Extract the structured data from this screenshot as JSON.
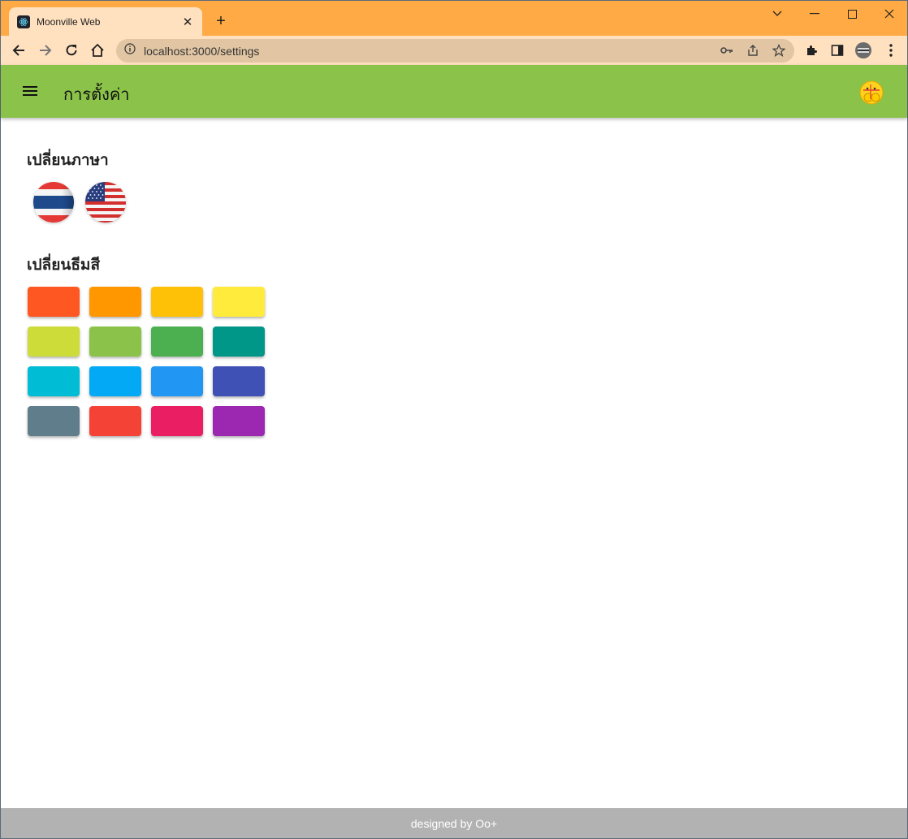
{
  "browser": {
    "tab_title": "Moonville Web",
    "url": "localhost:3000/settings"
  },
  "appbar": {
    "title": "การตั้งค่า"
  },
  "language_section": {
    "title": "เปลี่ยนภาษา",
    "flags": [
      "thai-flag",
      "us-flag"
    ]
  },
  "theme_section": {
    "title": "เปลี่ยนธีมสี",
    "colors": [
      "#ff5722",
      "#ff9800",
      "#ffc107",
      "#ffeb3b",
      "#cddc39",
      "#8bc34a",
      "#4caf50",
      "#009688",
      "#00bcd4",
      "#03a9f4",
      "#2196f3",
      "#3f51b5",
      "#607d8b",
      "#f44336",
      "#e91e63",
      "#9c27b0"
    ]
  },
  "footer": {
    "text": "designed by Oo+"
  },
  "colors": {
    "appbar": "#8bc34a",
    "titlebar": "#ffaa44",
    "toolbar": "#ffe1c0",
    "footer": "#b2b2b2"
  }
}
